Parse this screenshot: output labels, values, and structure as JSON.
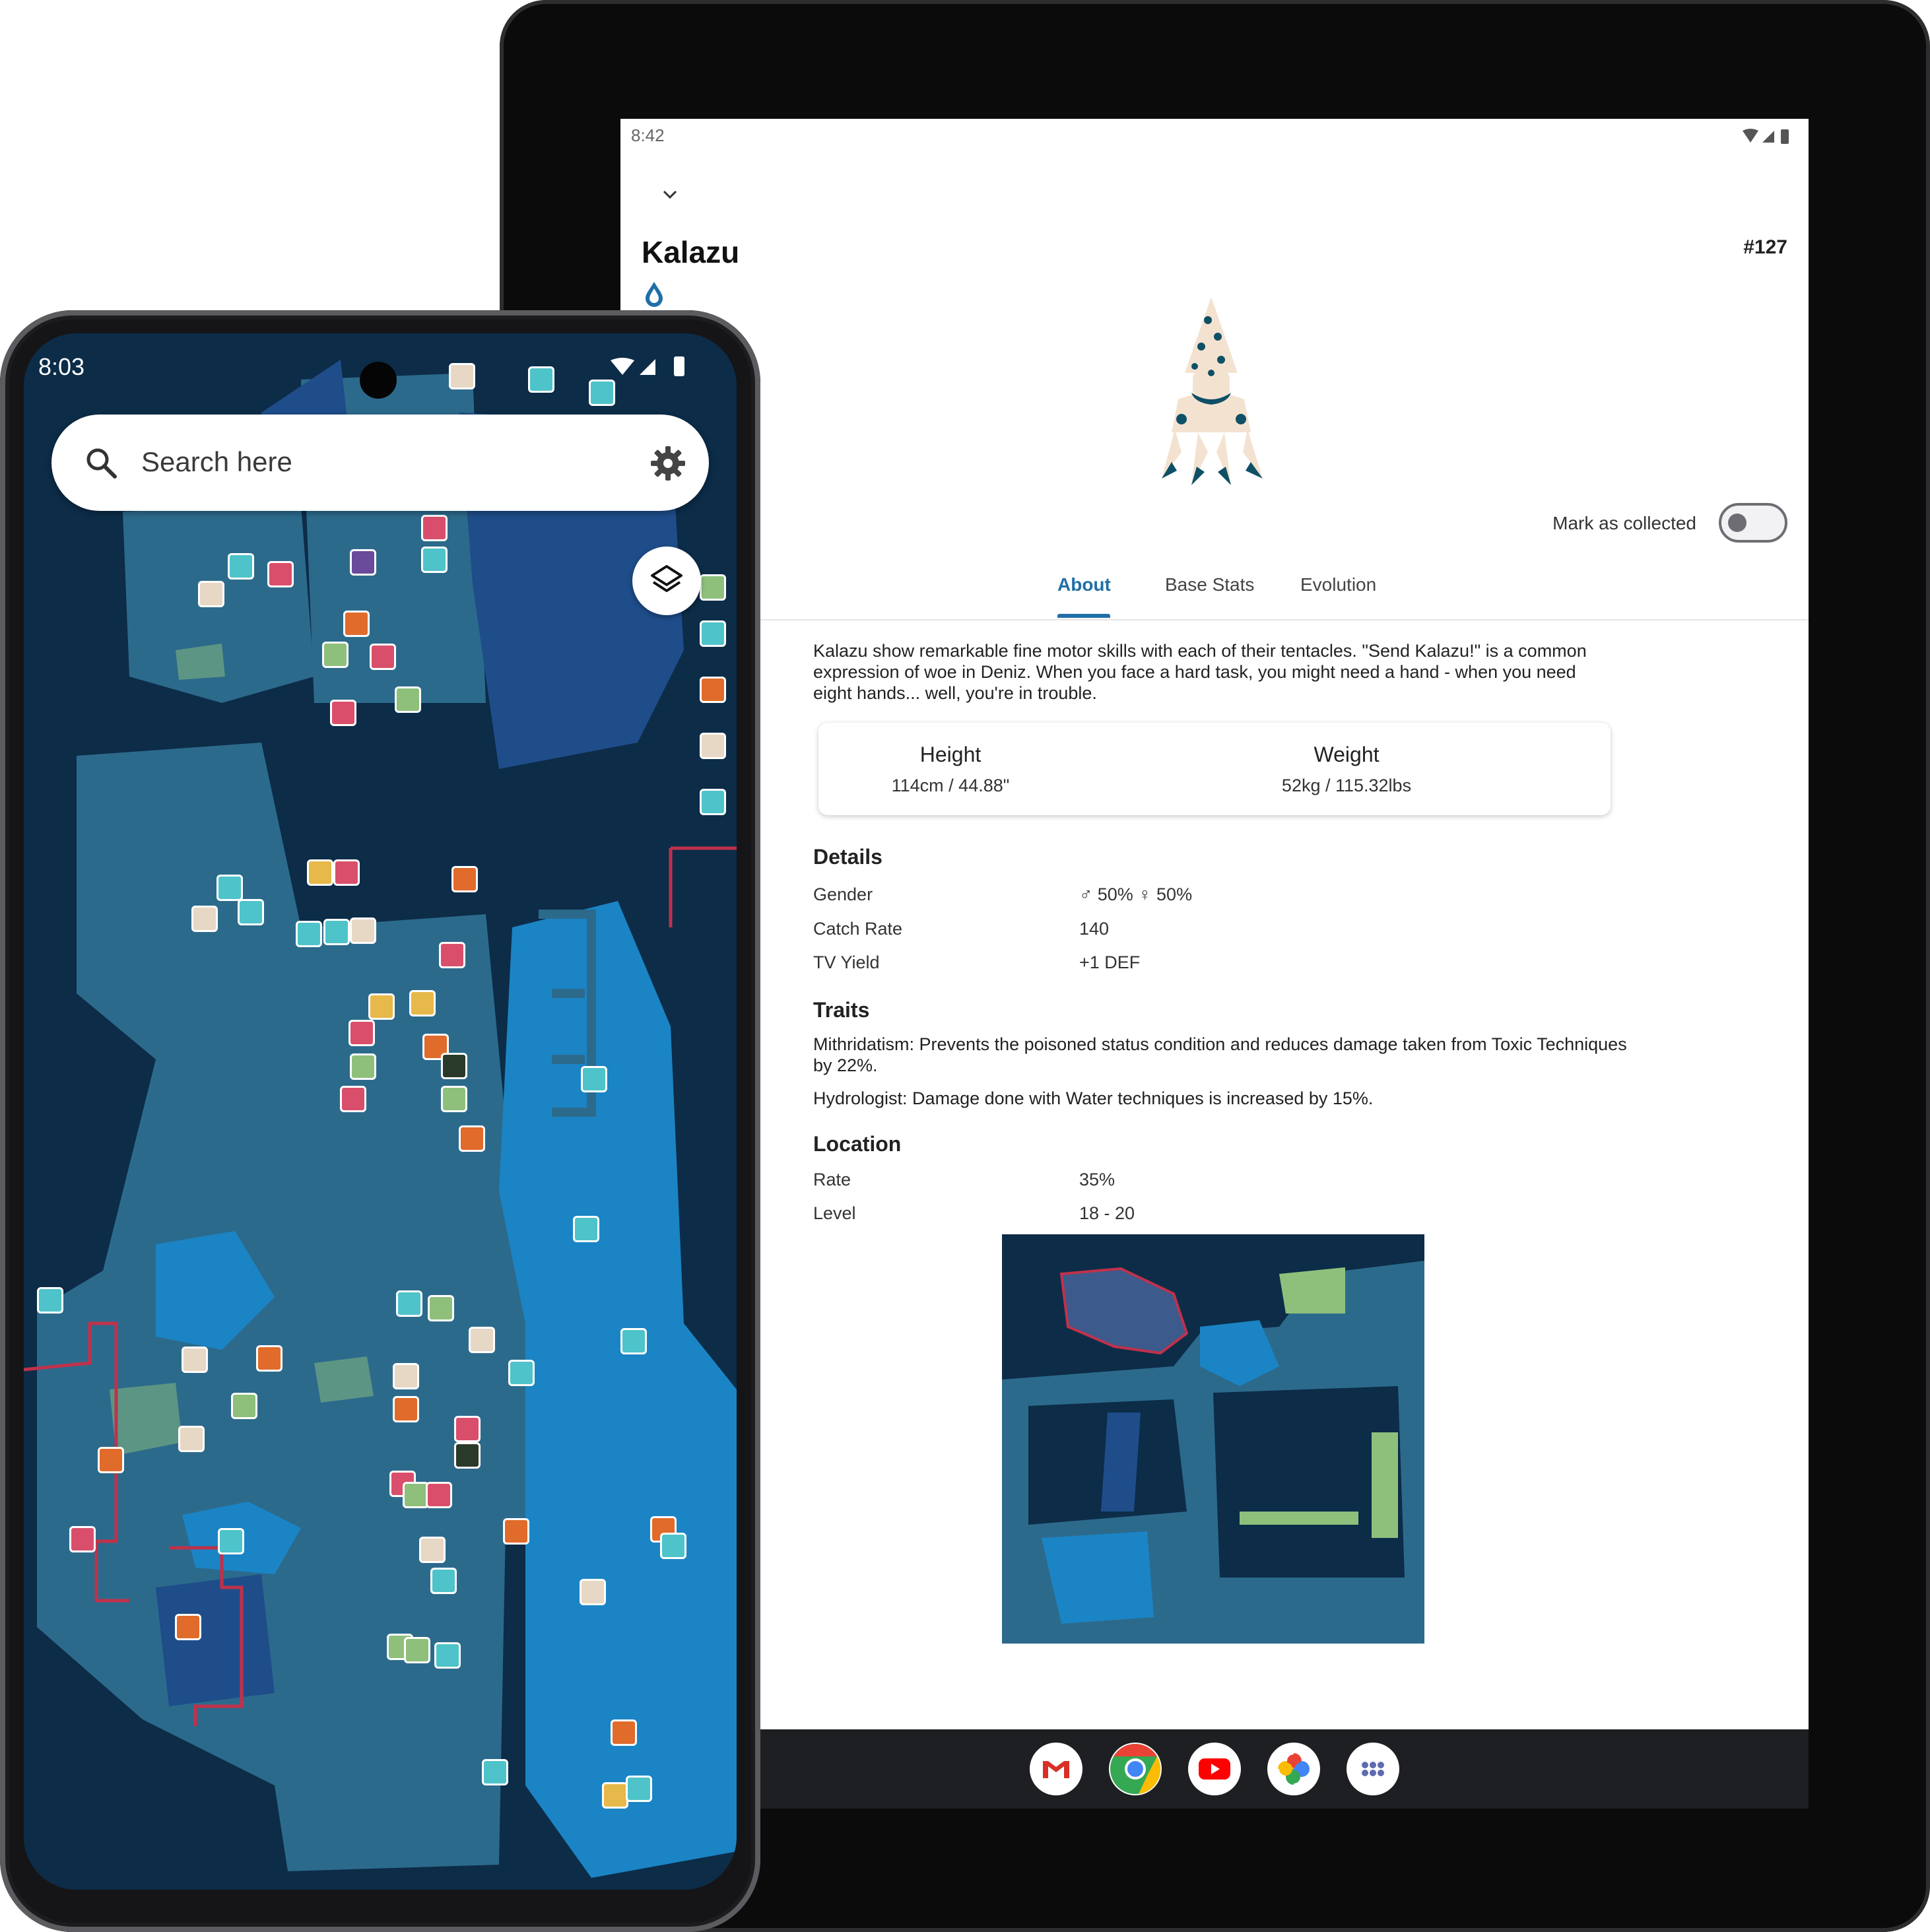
{
  "tablet": {
    "status_time": "8:42",
    "creature": {
      "name": "Kalazu",
      "number": "#127",
      "type_icon": "water-drop-icon",
      "mark_collected_label": "Mark as collected",
      "collected": false
    },
    "tabs": [
      {
        "label": "About",
        "active": true
      },
      {
        "label": "Base Stats",
        "active": false
      },
      {
        "label": "Evolution",
        "active": false
      }
    ],
    "description": "Kalazu show remarkable fine motor skills with each of their tentacles. \"Send Kalazu!\" is a common expression of woe in Deniz. When you face a hard task, you might need a hand - when you need eight hands... well, you're in trouble.",
    "size": {
      "height_label": "Height",
      "height_value": "114cm / 44.88\"",
      "weight_label": "Weight",
      "weight_value": "52kg / 115.32lbs"
    },
    "details": {
      "heading": "Details",
      "rows": [
        {
          "key": "Gender",
          "value": "♂ 50% ♀ 50%"
        },
        {
          "key": "Catch Rate",
          "value": "140"
        },
        {
          "key": "TV Yield",
          "value": "+1 DEF"
        }
      ]
    },
    "traits": {
      "heading": "Traits",
      "items": [
        "Mithridatism: Prevents the poisoned status condition and reduces damage taken from Toxic Techniques by 22%.",
        "Hydrologist: Damage done with Water techniques is increased by 15%."
      ]
    },
    "location": {
      "heading": "Location",
      "rows": [
        {
          "key": "Rate",
          "value": "35%"
        },
        {
          "key": "Level",
          "value": "18 - 20"
        }
      ]
    },
    "dock_apps": [
      "gmail-icon",
      "chrome-icon",
      "youtube-icon",
      "photos-icon",
      "app-drawer-icon"
    ]
  },
  "phone": {
    "status_time": "8:03",
    "search_placeholder": "Search here",
    "icons": [
      "search-icon",
      "gear-icon",
      "layers-icon"
    ]
  },
  "colors": {
    "accent": "#1f6fa8",
    "map_deep": "#0c2c48",
    "map_land": "#2c6a8c",
    "map_water": "#1b84c4",
    "zone_border": "#c0314b"
  }
}
